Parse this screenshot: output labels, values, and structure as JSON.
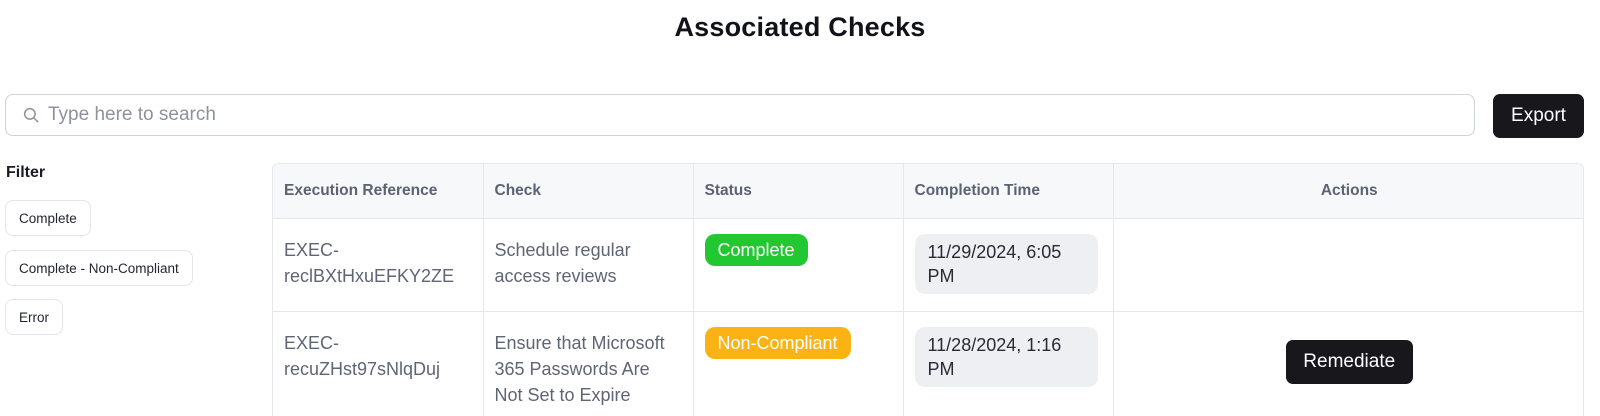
{
  "page": {
    "title": "Associated Checks"
  },
  "search": {
    "placeholder": "Type here to search",
    "value": ""
  },
  "toolbar": {
    "export_label": "Export"
  },
  "filter": {
    "label": "Filter",
    "options": [
      "Complete",
      "Complete - Non-Compliant",
      "Error"
    ]
  },
  "table": {
    "columns": [
      "Execution Reference",
      "Check",
      "Status",
      "Completion Time",
      "Actions"
    ],
    "rows": [
      {
        "reference": "EXEC-reclBXtHxuEFKY2ZE",
        "check": "Schedule regular access reviews",
        "status": "Complete",
        "completion_time": "11/29/2024, 6:05 PM",
        "action": ""
      },
      {
        "reference": "EXEC-recuZHst97sNlqDuj",
        "check": "Ensure that Microsoft 365 Passwords Are Not Set to Expire",
        "status": "Non-Compliant",
        "completion_time": "11/28/2024, 1:16 PM",
        "action": "Remediate"
      }
    ]
  },
  "colors": {
    "complete": "#22c832",
    "non_compliant": "#fbb214",
    "primary_button": "#17171c"
  },
  "icons": {
    "search": "search-icon"
  }
}
